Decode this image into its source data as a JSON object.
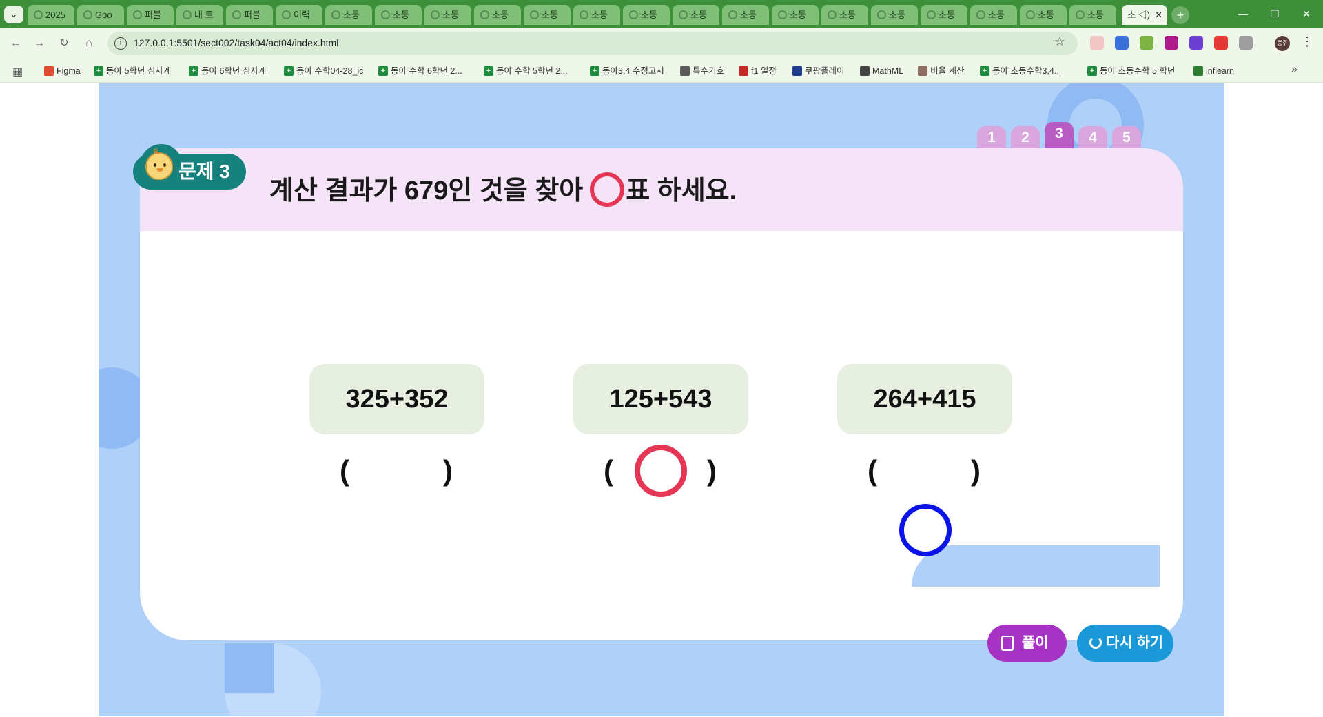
{
  "browser": {
    "tabs": [
      {
        "label": "2025"
      },
      {
        "label": "Goo"
      },
      {
        "label": "퍼블"
      },
      {
        "label": "내 트"
      },
      {
        "label": "퍼블"
      },
      {
        "label": "이력"
      },
      {
        "label": "초등"
      },
      {
        "label": "초등"
      },
      {
        "label": "초등"
      },
      {
        "label": "초등"
      },
      {
        "label": "초등"
      },
      {
        "label": "초등"
      },
      {
        "label": "초등"
      },
      {
        "label": "초등"
      },
      {
        "label": "초등"
      },
      {
        "label": "초등"
      },
      {
        "label": "초등"
      },
      {
        "label": "초등"
      },
      {
        "label": "초등"
      },
      {
        "label": "초등"
      },
      {
        "label": "초등"
      },
      {
        "label": "초등"
      }
    ],
    "active_tab": {
      "label": "초 ◁)"
    },
    "url": "127.0.0.1:5501/sect002/task04/act04/index.html",
    "bookmarks": [
      {
        "label": "Figma"
      },
      {
        "label": "동아 5학년 심사계"
      },
      {
        "label": "동아 6학년 심사계"
      },
      {
        "label": "동아 수학04-28_ic"
      },
      {
        "label": "동아 수학 6학년 2..."
      },
      {
        "label": "동아 수학 5학년 2..."
      },
      {
        "label": "동아3,4 수정고시"
      },
      {
        "label": "특수기호"
      },
      {
        "label": "f1 일정"
      },
      {
        "label": "쿠팡플레이"
      },
      {
        "label": "MathML"
      },
      {
        "label": "비율 계산"
      },
      {
        "label": "동아 초등수학3,4..."
      },
      {
        "label": "동아 초등수학 5 학년"
      },
      {
        "label": "inflearn"
      }
    ],
    "profile_initials": "종주"
  },
  "quiz": {
    "page_tabs": [
      "1",
      "2",
      "3",
      "4",
      "5"
    ],
    "active_page": "3",
    "badge_label": "문제 3",
    "question_before": "계산 결과가 679인 것을 찾아",
    "question_after": "표 하세요.",
    "options": [
      {
        "expression": "325+352",
        "marked": false
      },
      {
        "expression": "125+543",
        "marked": true
      },
      {
        "expression": "264+415",
        "marked": false
      }
    ],
    "paren_open": "(",
    "paren_close": ")",
    "solution_label": "풀이",
    "retry_label": "다시 하기"
  },
  "colors": {
    "accent_red": "#e63656",
    "accent_blue": "#0b14e8",
    "stage_bg": "#afd0f9",
    "badge_teal": "#17827d",
    "solution_purple": "#a633c4",
    "retry_blue": "#1b98d8"
  }
}
